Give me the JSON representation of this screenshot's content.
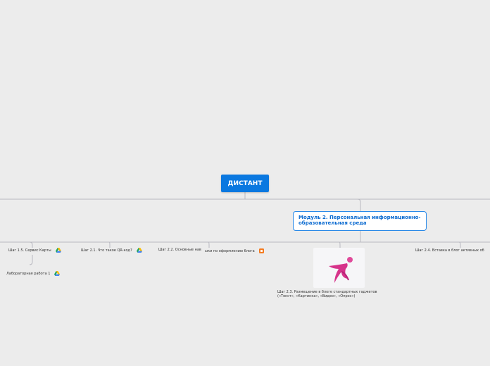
{
  "root": {
    "label": "ДИСТАНТ"
  },
  "module": {
    "label": "Модуль 2. Персональная информационно-образовательная среда"
  },
  "leaves": {
    "step15": "Шаг 1.5. Сервис Карты",
    "lab1": "Лабораторная работа 1",
    "step21": "Шаг 2.1. Что такое QR-код?",
    "step22": "Шаг 2.2. Основные нав",
    "blogtips": "ыки по оформлению блога",
    "step23": "Шаг 2.3. Размещение в блоге стандартных гаджетов («Текст», «Картинка», «Видео», «Опрос»)",
    "step24": "Шаг 2.4. Вставка в блог активных об"
  },
  "icons": {
    "drive": "google-drive-icon",
    "blogger": "blogger-icon",
    "thumbnail": "dancer-figure-image"
  },
  "colors": {
    "background": "#ececec",
    "root_fill": "#0a78e0",
    "module_border": "#2a8ae8",
    "module_text": "#0a6ad0",
    "connector": "#b8b8c0"
  }
}
